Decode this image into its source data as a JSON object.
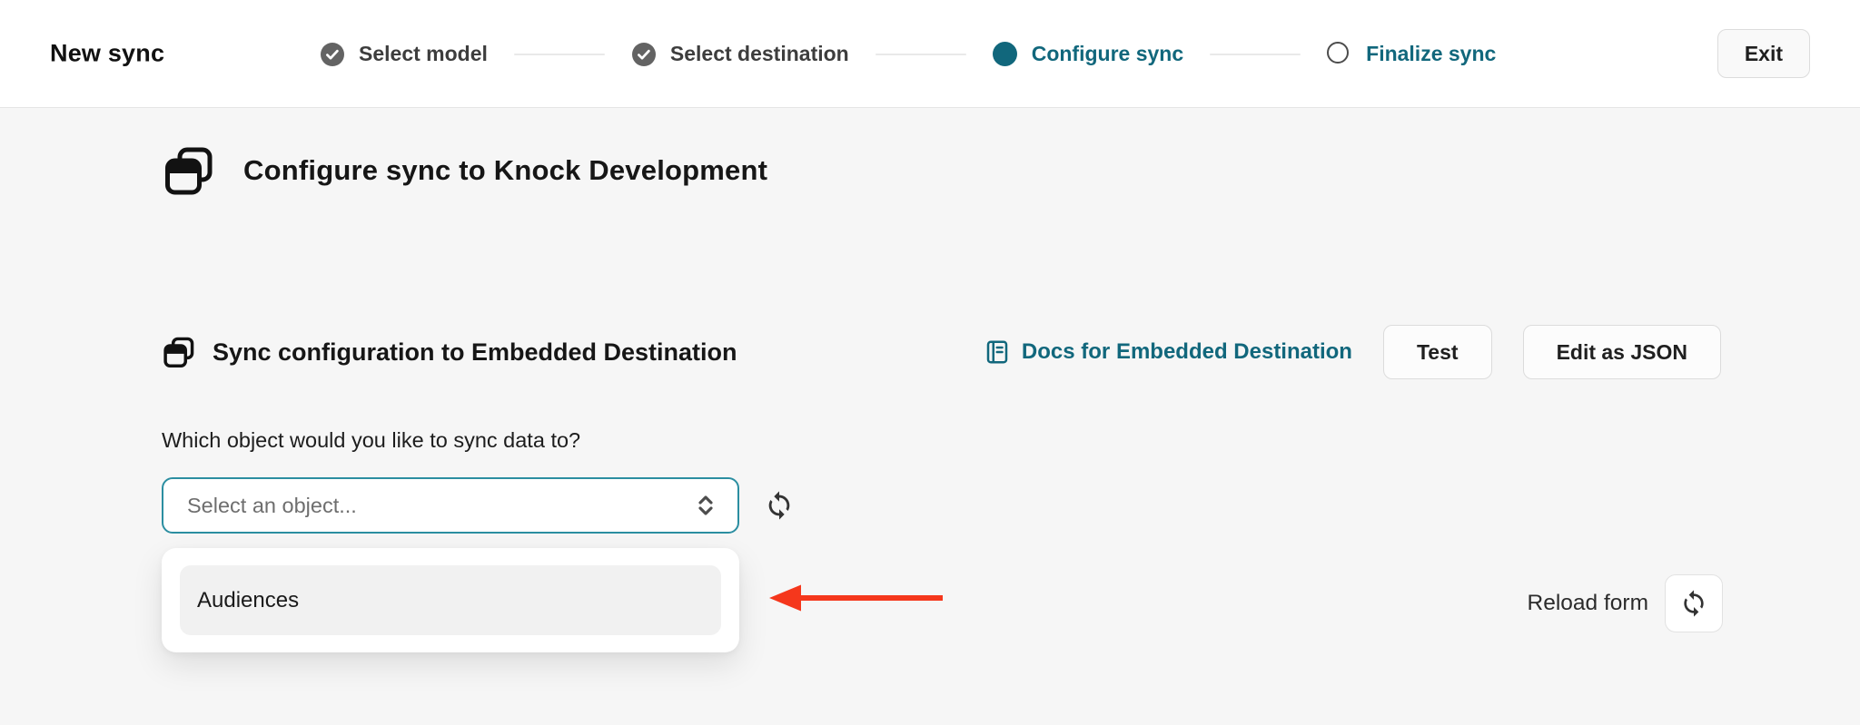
{
  "header": {
    "title": "New sync",
    "exit_button": "Exit",
    "steps": [
      {
        "label": "Select model",
        "state": "complete"
      },
      {
        "label": "Select destination",
        "state": "complete"
      },
      {
        "label": "Configure sync",
        "state": "current"
      },
      {
        "label": "Finalize sync",
        "state": "upcoming"
      }
    ]
  },
  "content": {
    "heading": "Configure sync to Knock Development",
    "config_section": {
      "heading": "Sync configuration to Embedded Destination",
      "docs_link": "Docs for Embedded Destination",
      "test_button": "Test",
      "edit_json_button": "Edit as JSON"
    },
    "object_field": {
      "label": "Which object would you like to sync data to?",
      "placeholder": "Select an object...",
      "options": [
        {
          "label": "Audiences",
          "highlighted": true
        }
      ]
    },
    "reload_form": {
      "label": "Reload form"
    }
  },
  "colors": {
    "accent_teal": "#11677c",
    "arrow_red": "#f5371c",
    "step_complete_gray": "#636363",
    "select_focus_border": "#2b8ea1",
    "option_highlight": "#f1f1f1",
    "page_background": "#f6f6f6"
  },
  "icons": {
    "step_complete": "check-circle-icon",
    "step_current": "filled-dot-icon",
    "step_upcoming": "empty-circle-icon",
    "page_heading": "browser-windows-icon",
    "docs": "book-icon",
    "select_control": "chevron-up-down-icon",
    "refresh": "sync-icon",
    "annotation": "red-arrow-left-icon"
  }
}
